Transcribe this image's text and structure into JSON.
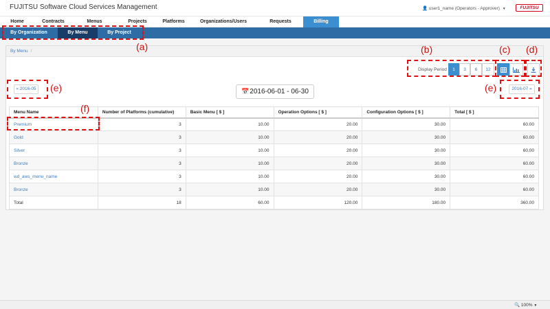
{
  "app": {
    "title": "FUJITSU Software Cloud Services Management",
    "user": "user1_name (Operators - Approver)",
    "brand": "FUJITSU"
  },
  "top_nav": [
    {
      "label": "Home"
    },
    {
      "label": "Contracts"
    },
    {
      "label": "Menus"
    },
    {
      "label": "Projects"
    },
    {
      "label": "Platforms"
    },
    {
      "label": "Organizations/Users"
    },
    {
      "label": "Requests"
    },
    {
      "label": "Billing",
      "active": true
    }
  ],
  "sub_nav": [
    {
      "label": "By Organization"
    },
    {
      "label": "By Menu",
      "active": true
    },
    {
      "label": "By Project"
    }
  ],
  "breadcrumb": {
    "current": "By Menu",
    "separator": "/"
  },
  "display_period": {
    "label": "Display Period",
    "options": [
      "1",
      "3",
      "6",
      "12"
    ],
    "selected": "1"
  },
  "view_buttons": {
    "table_icon": "table-icon",
    "chart_icon": "bar-chart-icon",
    "download_icon": "download-icon"
  },
  "period_nav": {
    "prev_label": "« 2016-05",
    "next_label": "2016-07 »",
    "current_range": "2016-06-01 - 06-30"
  },
  "table": {
    "headers": [
      "Menu Name",
      "Number of Platforms (cumulative)",
      "Basic Menu [ $ ]",
      "Operation Options [ $ ]",
      "Configuration Options [ $ ]",
      "Total [ $ ]"
    ],
    "rows": [
      {
        "name": "Premium",
        "platforms": "3",
        "basic": "10.00",
        "operation": "20.00",
        "configuration": "30.00",
        "total": "60.00"
      },
      {
        "name": "Gold",
        "platforms": "3",
        "basic": "10.00",
        "operation": "20.00",
        "configuration": "30.00",
        "total": "60.00"
      },
      {
        "name": "Silver",
        "platforms": "3",
        "basic": "10.00",
        "operation": "20.00",
        "configuration": "30.00",
        "total": "60.00"
      },
      {
        "name": "Bronze",
        "platforms": "3",
        "basic": "10.00",
        "operation": "20.00",
        "configuration": "30.00",
        "total": "60.00"
      },
      {
        "name": "wd_aws_menu_name",
        "platforms": "3",
        "basic": "10.00",
        "operation": "20.00",
        "configuration": "30.00",
        "total": "60.00"
      },
      {
        "name": "Bronze",
        "platforms": "3",
        "basic": "10.00",
        "operation": "20.00",
        "configuration": "30.00",
        "total": "60.00"
      }
    ],
    "total_row": {
      "name": "Total",
      "platforms": "18",
      "basic": "60.00",
      "operation": "120.00",
      "configuration": "180.00",
      "total": "360.00"
    }
  },
  "callouts": {
    "a": "(a)",
    "b": "(b)",
    "c": "(c)",
    "d": "(d)",
    "e_left": "(e)",
    "e_right": "(e)",
    "f": "(f)"
  },
  "status": {
    "zoom": "100%"
  },
  "colors": {
    "primary": "#3b8ed0",
    "subnav": "#2e6ca6",
    "subnav_active": "#173d68",
    "link": "#3b7bc0",
    "callout": "#e01010"
  }
}
